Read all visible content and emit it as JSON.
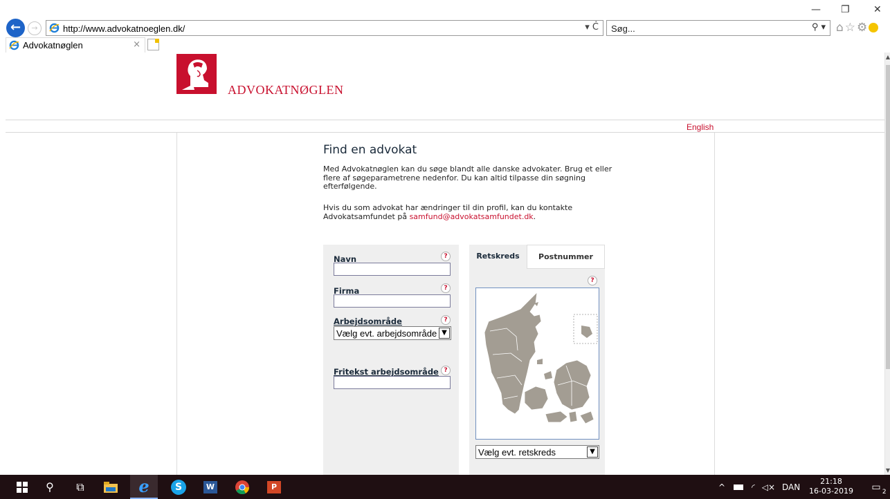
{
  "browser": {
    "url": "http://www.advokatnoeglen.dk/",
    "search_placeholder": "Søg...",
    "tab_title": "Advokatnøglen",
    "window_controls": {
      "minimize": "—",
      "restore": "❐",
      "close": "✕"
    },
    "addr_tools": "▾ Ċ",
    "search_icon": "⚲ ▾",
    "toolbar_icons": "⌂☆⚙"
  },
  "site": {
    "logo_text": "ADVOKATNØGLEN",
    "language_link": "English",
    "brand_color": "#c8102e"
  },
  "main": {
    "title": "Find en advokat",
    "intro": "Med Advokatnøglen kan du søge blandt alle danske advokater. Brug et eller flere af søgeparametrene nedenfor. Du kan altid tilpasse din søgning efterfølgende.",
    "contact_text": "Hvis du som advokat har ændringer til din profil, kan du kontakte Advokatsamfundet på ",
    "contact_email": "samfund@advokatsamfundet.dk",
    "contact_end": "."
  },
  "form": {
    "name_label": "Navn",
    "firm_label": "Firma",
    "area_label": "Arbejdsområde",
    "area_select": "Vælg evt. arbejdsområde",
    "freetext_label": "Fritekst arbejdsområde",
    "help": "?"
  },
  "map": {
    "tab_active": "Retskreds",
    "tab_inactive": "Postnummer",
    "select": "Vælg evt. retskreds",
    "land_color": "#a39d93"
  },
  "taskbar": {
    "language": "DAN",
    "time": "21:18",
    "date": "16-03-2019",
    "notifications": "2"
  }
}
